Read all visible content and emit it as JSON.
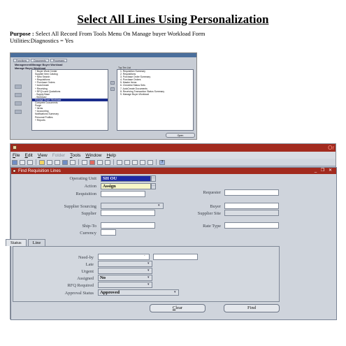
{
  "doc": {
    "title": "Select All Lines Using Personalization",
    "purpose_label": "Purpose :",
    "purpose_text": " Select All Record From Tools Menu On Manage buyer Workload Form",
    "utilities_text": "Utilities:Diagnostics  = Yes"
  },
  "shot1": {
    "tabs": [
      "Functions",
      "Documents",
      "Processes"
    ],
    "form_title_1": "Management/Manage Buyer Workload",
    "form_title_2": "Manage Buyer Workload",
    "top_ten_label": "Top Ten List",
    "left_items": [
      "+ Buyer Work Center",
      "  Supplier Item Catalog",
      "+ New Search",
      "+ Requisitions",
      "+ Purchase Orders",
      "+ AutoCreate",
      "+ Receiving",
      "+ RFQ's and Quotations",
      "- Supply Base",
      "  - Workload",
      "      Manage Buyer Workload",
      "      Complete Documents",
      "      Purge",
      "+ Items",
      "+ Accounting",
      "  Notifications Summary",
      "  Personal Profiles",
      "+ Reports"
    ],
    "selected_left_index": 10,
    "right_items": [
      "1. Requisition Summary",
      "2. Requisitions",
      "3. Purchase Order Summary",
      "4. Purchase Orders",
      "5. Master Items",
      "6. Checklist Status Sets",
      "7. AutoCreate Documents",
      "8. Receiving Transaction Status Summary",
      "9. Manage Buyer Workload"
    ],
    "open_button": "Open"
  },
  "shot2": {
    "app_title": "Or",
    "menu": [
      {
        "label": "File",
        "u": "F",
        "rest": "ile",
        "disabled": false
      },
      {
        "label": "Edit",
        "u": "E",
        "rest": "dit",
        "disabled": false
      },
      {
        "label": "View",
        "u": "V",
        "rest": "iew",
        "disabled": false
      },
      {
        "label": "Folder",
        "u": "",
        "rest": "Folder",
        "disabled": true
      },
      {
        "label": "Tools",
        "u": "T",
        "rest": "ools",
        "disabled": false
      },
      {
        "label": "Window",
        "u": "W",
        "rest": "indow",
        "disabled": false
      },
      {
        "label": "Help",
        "u": "H",
        "rest": "elp",
        "disabled": false
      }
    ],
    "form_title": "Find Requisition Lines",
    "window_controls": "_ ❐ ✕",
    "fields": {
      "operating_unit_label": "Operating Unit",
      "operating_unit_value": "SH OU",
      "action_label": "Action",
      "action_value": "Assign",
      "requisition_label": "Requisition",
      "requester_label": "Requester",
      "supplier_sourcing_label": "Supplier Sourcing",
      "buyer_label": "Buyer",
      "supplier_label": "Supplier",
      "supplier_site_label": "Supplier Site",
      "ship_to_label": "Ship-To",
      "rate_type_label": "Rate Type",
      "currency_label": "Currency"
    },
    "tabs": [
      "Status",
      "Line"
    ],
    "status": {
      "need_by_label": "Need-by",
      "late_label": "Late",
      "urgent_label": "Urgent",
      "assigned_label": "Assigned",
      "assigned_value": "No",
      "rfq_required_label": "RFQ Required",
      "approval_status_label": "Approval Status",
      "approval_status_value": "Approved"
    },
    "clear_u": "C",
    "clear_rest": "lear",
    "find_label": "Find"
  }
}
